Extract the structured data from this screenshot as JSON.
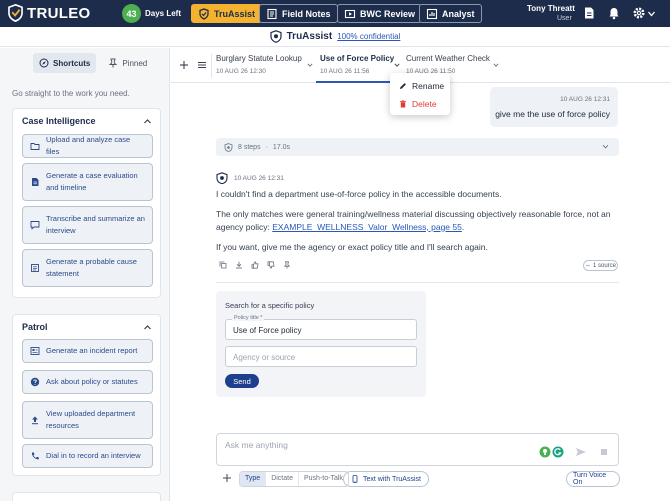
{
  "app": {
    "logo_text": "TRULEO",
    "days_count": "43",
    "days_label": "Days Left"
  },
  "nav": [
    {
      "label": "TruAssist",
      "icon": "shield-icon",
      "active": true
    },
    {
      "label": "Field Notes",
      "icon": "notes-icon",
      "active": false
    },
    {
      "label": "BWC Review",
      "icon": "video-icon",
      "active": false
    },
    {
      "label": "Analyst",
      "icon": "chart-icon",
      "active": false
    }
  ],
  "user": {
    "name": "Tony Threatt",
    "role": "User"
  },
  "header": {
    "title": "TruAssist",
    "confidential": "100% confidential"
  },
  "sidebar": {
    "tabs": [
      {
        "label": "Shortcuts",
        "active": true
      },
      {
        "label": "Pinned",
        "active": false
      }
    ],
    "hint": "Go straight to the work you need.",
    "sections": [
      {
        "title": "Case Intelligence",
        "items": [
          {
            "label": "Upload and analyze case files",
            "icon": "folder-icon"
          },
          {
            "label": "Generate a case evaluation and timeline",
            "icon": "document-icon"
          },
          {
            "label": "Transcribe and summarize an interview",
            "icon": "chat-icon"
          },
          {
            "label": "Generate a probable cause statement",
            "icon": "statement-icon"
          }
        ]
      },
      {
        "title": "Patrol",
        "items": [
          {
            "label": "Generate an incident report",
            "icon": "report-icon"
          },
          {
            "label": "Ask about policy or statutes",
            "icon": "question-icon"
          },
          {
            "label": "View uploaded department resources",
            "icon": "upload-icon"
          },
          {
            "label": "Dial in to record an interview",
            "icon": "phone-icon"
          }
        ]
      }
    ]
  },
  "conversation_tabs": [
    {
      "title": "Burglary Statute Lookup",
      "date": "10 AUG 26 12:30",
      "active": false
    },
    {
      "title": "Use of Force Policy",
      "date": "10 AUG 26 11:56",
      "active": true
    },
    {
      "title": "Current Weather Check",
      "date": "10 AUG 26 11:50",
      "active": false
    }
  ],
  "tab_menu": {
    "rename": "Rename",
    "delete": "Delete"
  },
  "chat": {
    "user_message": {
      "timestamp": "10 AUG 26 12:31",
      "text": "give me the use of force policy"
    },
    "steps": {
      "label": "8 steps",
      "duration": "17.0s"
    },
    "answer": {
      "timestamp": "10 AUG 26 12:31",
      "p1": "I couldn't find a department use-of-force policy in the accessible documents.",
      "p2_before": "The only matches were general training/wellness material discussing objectively reasonable force, not an agency policy: ",
      "p2_link": "EXAMPLE_WELLNESS_Valor_Wellness, page 55",
      "p2_after": ".",
      "p3": "If you want, give me the agency or exact policy title and I'll search again.",
      "source_chip": "1 source"
    },
    "form": {
      "title": "Search for a specific policy",
      "policy_label": "Policy title *",
      "policy_value": "Use of Force policy",
      "agency_placeholder": "Agency or source",
      "send_label": "Send"
    }
  },
  "composer": {
    "placeholder": "Ask me anything",
    "modes": [
      {
        "label": "Type",
        "active": true
      },
      {
        "label": "Dictate",
        "active": false
      },
      {
        "label": "Push-to-Talk",
        "active": false
      }
    ],
    "text_button": "Text with TruAssist",
    "voice_button": "Turn Voice On"
  },
  "colors": {
    "topbar": "#1d2c4a",
    "accent": "#f4b22e",
    "link": "#2a57b8",
    "badge": "#4caf50",
    "danger": "#e53935"
  }
}
